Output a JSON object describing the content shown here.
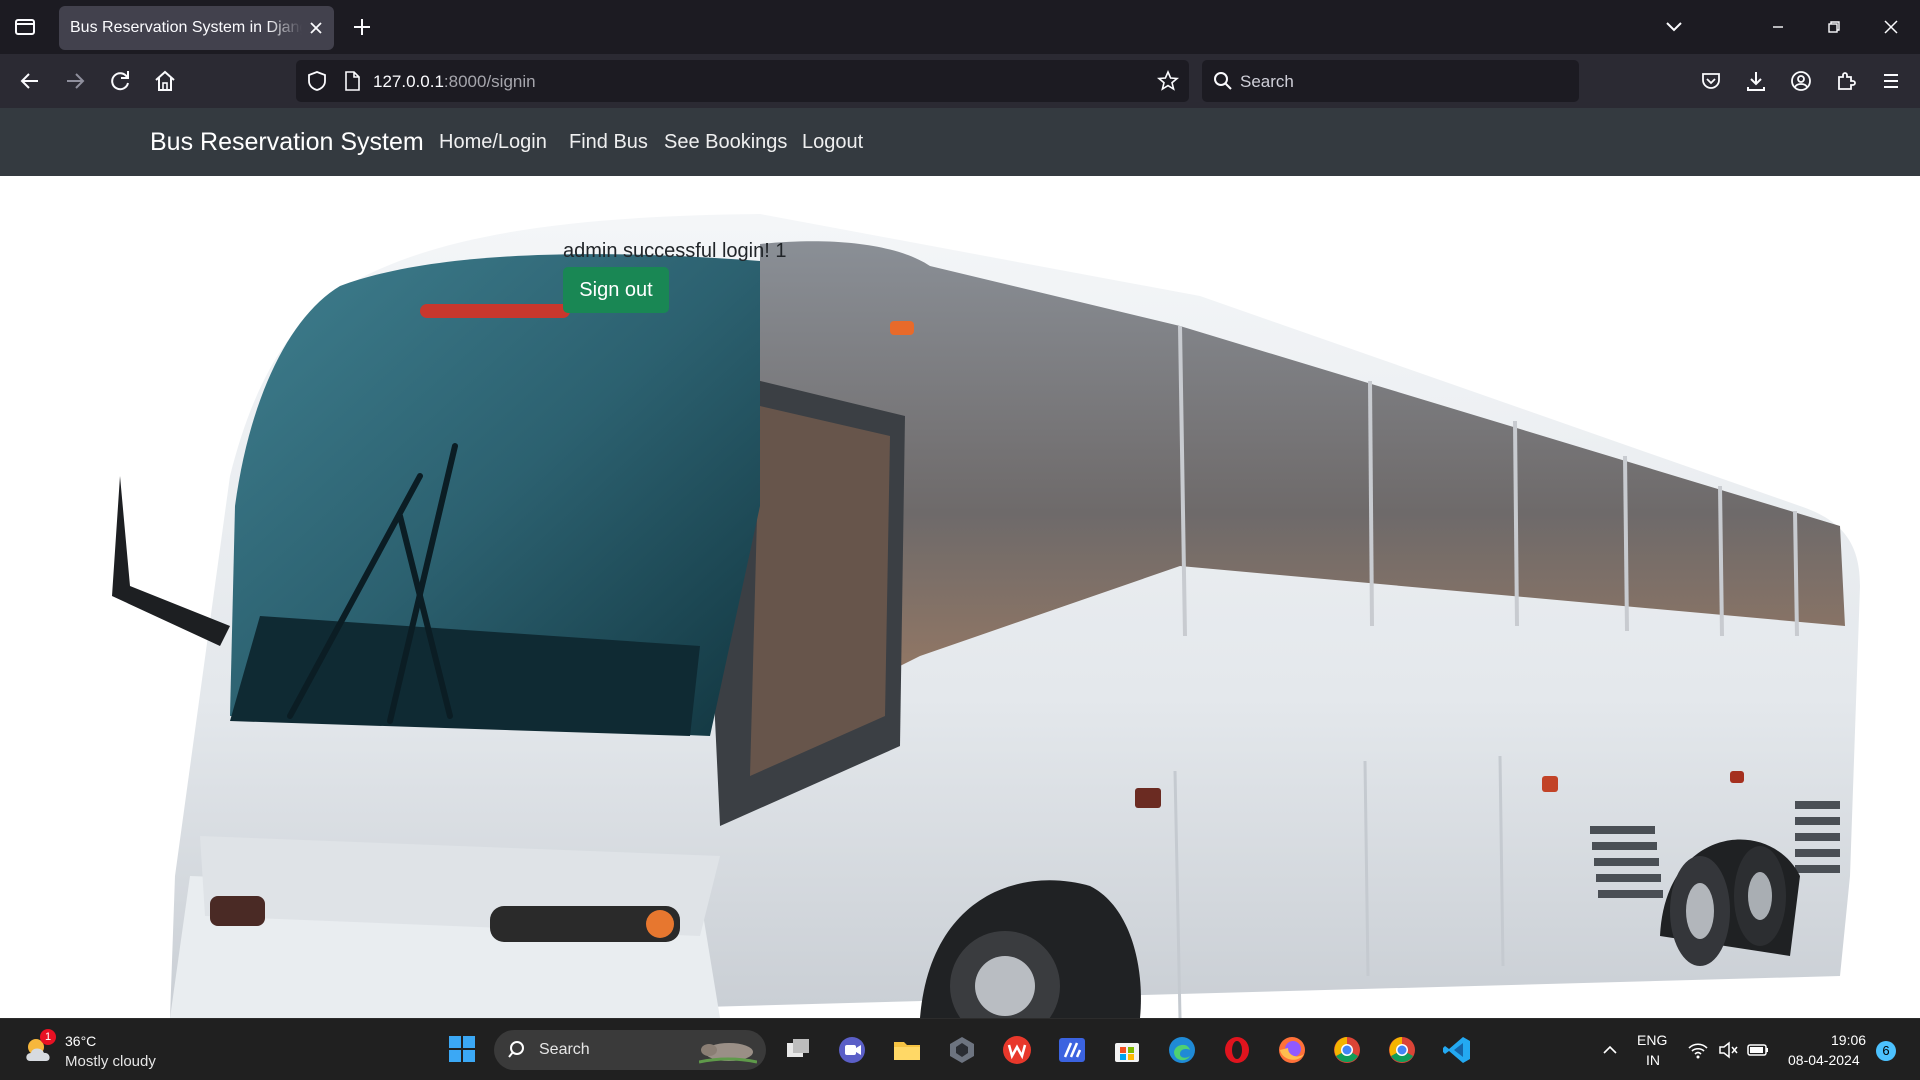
{
  "browser": {
    "tab_title": "Bus Reservation System in Django Project",
    "url_host": "127.0.0.1",
    "url_path": ":8000/signin",
    "search_placeholder": "Search"
  },
  "site": {
    "brand": "Bus Reservation System",
    "nav": [
      {
        "label": "Home/Login"
      },
      {
        "label": "Find Bus"
      },
      {
        "label": "See Bookings"
      },
      {
        "label": "Logout"
      }
    ],
    "message": "admin successful login! 1",
    "signout_label": "Sign out",
    "button_color": "#198754",
    "navbar_color": "#343a40"
  },
  "taskbar": {
    "weather_temp": "36°C",
    "weather_desc": "Mostly cloudy",
    "weather_badge": "1",
    "search_label": "Search",
    "language": "ENG",
    "region": "IN",
    "time": "19:06",
    "date": "08-04-2024",
    "notification_count": "6",
    "apps": [
      "task-view-icon",
      "meet-icon",
      "file-explorer-icon",
      "app-icon",
      "wps-icon",
      "app-icon",
      "store-icon",
      "edge-icon",
      "opera-icon",
      "firefox-icon",
      "chrome-icon",
      "chrome-icon",
      "vscode-icon"
    ]
  }
}
